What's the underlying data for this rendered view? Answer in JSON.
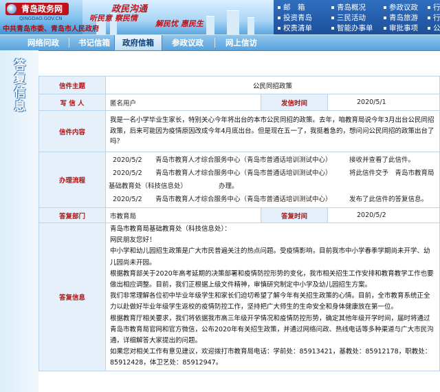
{
  "header": {
    "logo_text": "青岛政务网",
    "logo_url": "QINGDAO.GOV.CN",
    "logo_sub": "中共青岛市委、青岛市人民政府",
    "slogan_main": "政民沟通",
    "slogan_left": "听民意 察民情",
    "slogan_right": "解民忧 惠民生",
    "top_links": [
      "邮　箱",
      "青岛概况",
      "参政议政",
      "行政资",
      "投资青岛",
      "三民活动",
      "青岛旅游",
      "行政执",
      "权责清单",
      "智能办事单",
      "审批事项",
      "公共服"
    ]
  },
  "nav": {
    "tabs": [
      "网络问政",
      "书记信箱",
      "政府信箱",
      "参政议政",
      "网上信访"
    ],
    "active": "政府信箱"
  },
  "sidebar": {
    "title": "答复信息"
  },
  "letter": {
    "subject_label": "信件主题",
    "subject": "公民同招政策",
    "writer_label": "写 信 人",
    "writer": "匿名用户",
    "send_time_label": "发信时间",
    "send_time": "2020/5/1",
    "content_label": "信件内容",
    "content": "我是一名小学毕业生家长，特别关心今年将出台的本市公民同招的政策。去年，咱教育局说今年3月出台公民同招政策，后来可能因为疫情原因改成今年4月底出台。但是现在五一了，我挺着急的，想问问公民同招的政策出台了吗？"
  },
  "process": {
    "label": "办理流程",
    "lines": [
      {
        "date": "2020/5/2",
        "org": "青岛市教育人才综合服务中心（青岛市普通话培训测试中心）",
        "action": "接收并查看了此信件。"
      },
      {
        "date": "2020/5/2",
        "org": "青岛市教育人才综合服务中心（青岛市普通话培训测试中心）",
        "action": "将此信件交予　青岛市教育局"
      },
      {
        "date": "",
        "org": "基础教育处（科技信息处）",
        "action": "办理。"
      },
      {
        "date": "2020/5/2",
        "org": "青岛市教育人才综合服务中心（青岛市普通话培训测试中心）",
        "action": "发布了此信件的答复信息。"
      }
    ]
  },
  "reply_meta": {
    "dept_label": "答复部门",
    "dept": "市教育局",
    "time_label": "答复时间",
    "time": "2020/5/2"
  },
  "reply": {
    "label": "答复信息",
    "paragraphs": [
      "青岛市教育局基础教育处（科技信息处）：",
      "网民朋友您好！",
      "中小学和幼儿园招生政策是广大市民普遍关注的热点问题。受疫情影响，目前我市中小学春季学期尚未开学、幼儿园尚未开园。",
      "根据教育部关于2020年高考延期的决策部署和疫情防控形势的变化，我市相关招生工作安排和教育教学工作也要做出相应调整。目前，我们正根据上级文件精神，审慎研究制定中小学及幼儿园招生方案。",
      "我们非常理解各位初中毕业年级学生和家长们迫切希望了解今年有关招生政策的心情。目前，全市教育系统正全力以赴做好毕业年级学生返校的疫情防控工作，坚持把广大师生的生命安全和身体健康放在第一位。",
      "根据教育厅相关要求，我们将依据我市高三年级开学情况和疫情防控形势，确定其他年级开学时间，届时将通过青岛市教育局官网和官方微信，公布2020年有关招生政策，并通过网络问政、热线电话等多种渠道与广大市民沟通，详细解答大家提出的问题。",
      "如果您对相关工作有意见建议，欢迎拨打市教育局电话：学前处：85913421，基教处：85912178，职教处：85912428，体卫艺处：85912947。"
    ]
  },
  "colors": {
    "label_red": "#b31515",
    "label_bg": "#e5f0fa",
    "border": "#b9d3ea",
    "nav_blue": "#5aa3dc"
  }
}
